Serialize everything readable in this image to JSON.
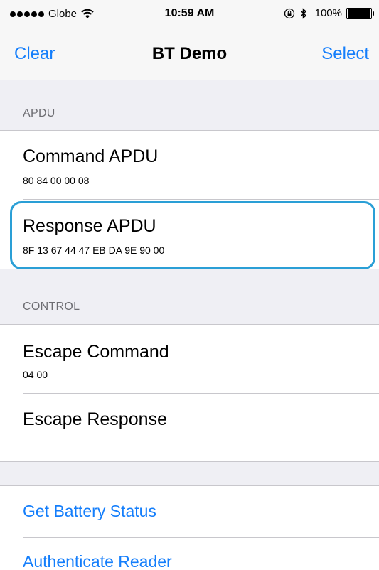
{
  "status_bar": {
    "carrier": "Globe",
    "time": "10:59 AM",
    "battery_percent": "100%",
    "battery_level": 1.0
  },
  "nav": {
    "left_label": "Clear",
    "title": "BT Demo",
    "right_label": "Select"
  },
  "sections": {
    "apdu": {
      "header": "APDU",
      "command_title": "Command APDU",
      "command_value": "80 84 00 00 08",
      "response_title": "Response APDU",
      "response_value": "8F 13 67 44 47 EB DA 9E 90 00"
    },
    "control": {
      "header": "CONTROL",
      "escape_command_title": "Escape Command",
      "escape_command_value": "04 00",
      "escape_response_title": "Escape Response"
    },
    "actions": {
      "get_battery_status": "Get Battery Status",
      "authenticate_reader": "Authenticate Reader"
    }
  },
  "colors": {
    "tint": "#147efb",
    "highlight": "#2a9fd6",
    "background": "#efeff4"
  }
}
